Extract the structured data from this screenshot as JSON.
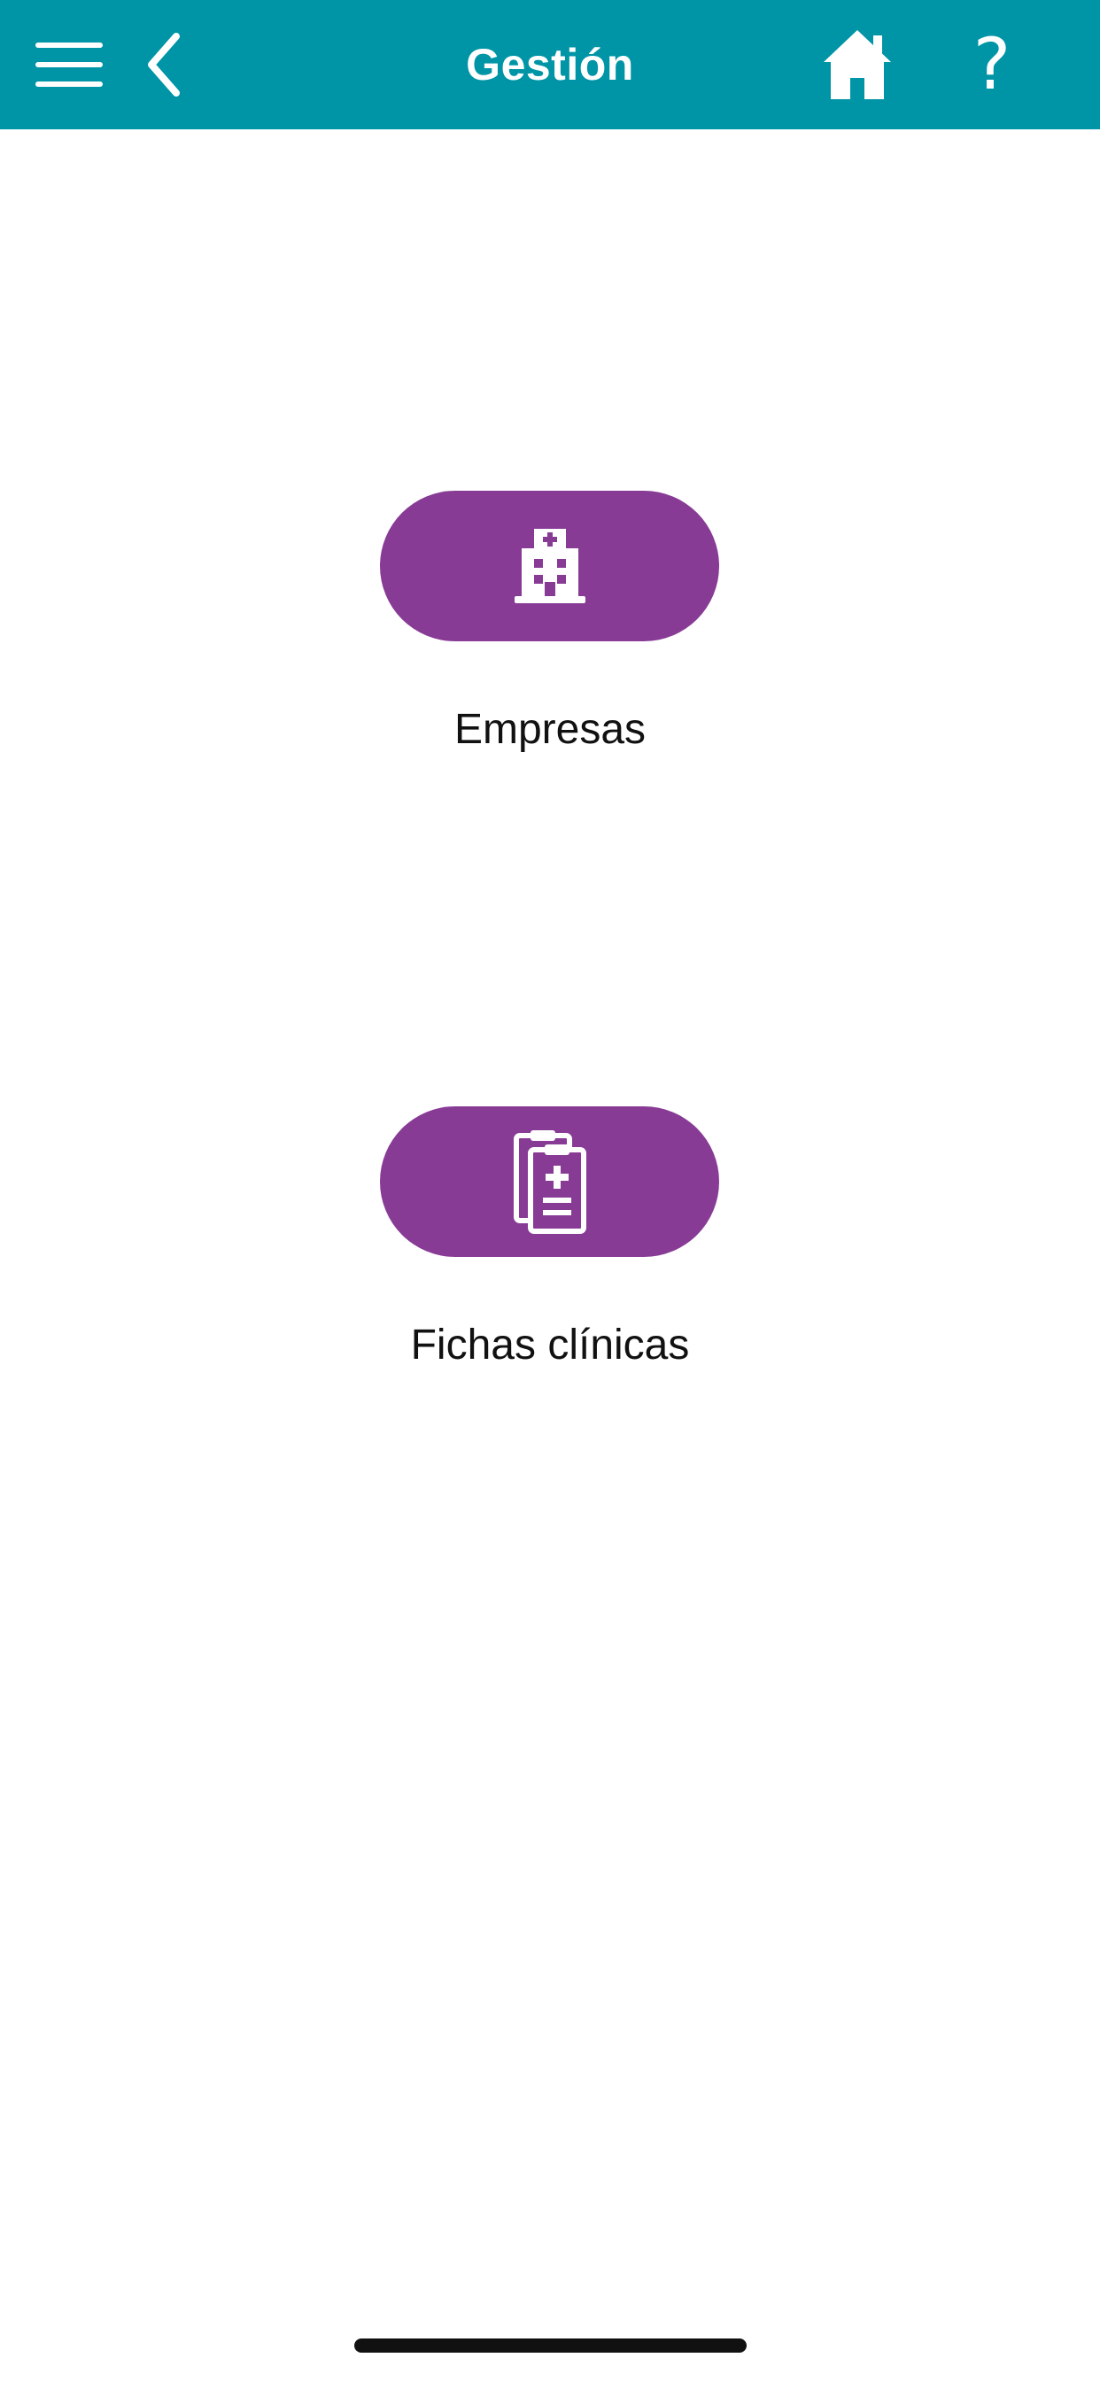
{
  "colors": {
    "header_bg": "#0095a6",
    "pill_bg": "#873b95",
    "icon": "#ffffff"
  },
  "header": {
    "title": "Gestión",
    "icons": [
      "menu-icon",
      "back-chevron-icon",
      "home-icon",
      "help-icon"
    ],
    "help_glyph": "?"
  },
  "actions": [
    {
      "icon": "hospital-building-icon",
      "label": "Empresas"
    },
    {
      "icon": "medical-clipboard-icon",
      "label": "Fichas clínicas"
    }
  ]
}
